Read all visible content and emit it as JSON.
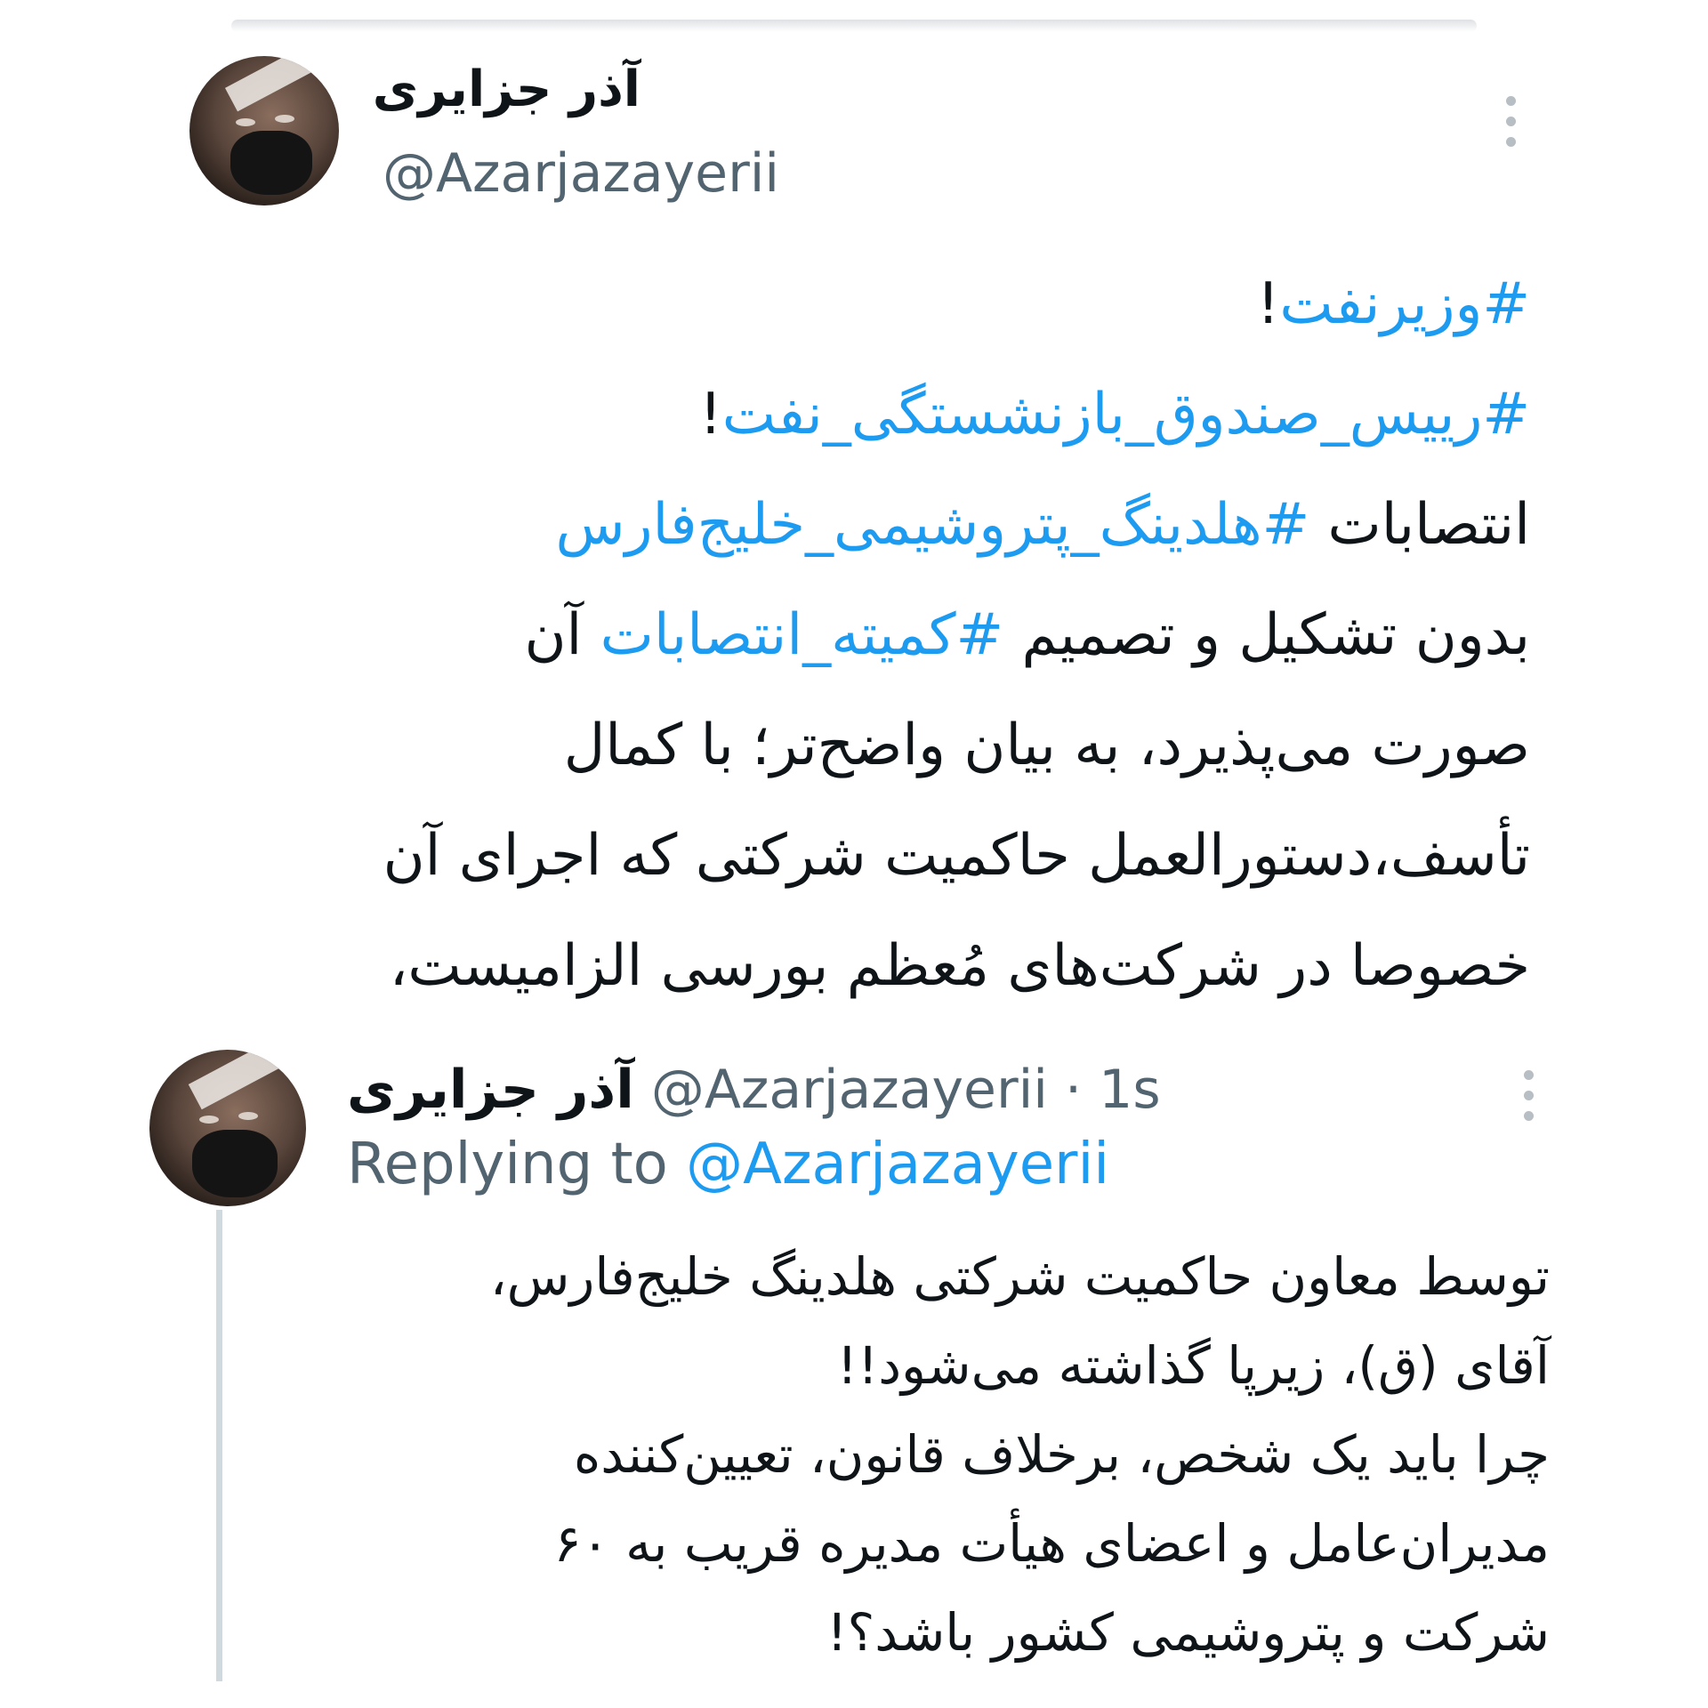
{
  "main_tweet": {
    "display_name": "آذر جزایری",
    "handle": "@Azarjazayerii",
    "lines": [
      [
        {
          "text": "#وزیرنفت",
          "tag": true
        },
        {
          "text": "!",
          "tag": false
        }
      ],
      [
        {
          "text": "#رییس_صندوق_بازنشستگی_نفت",
          "tag": true
        },
        {
          "text": "!",
          "tag": false
        }
      ],
      [
        {
          "text": "انتصابات ",
          "tag": false
        },
        {
          "text": "#هلدینگ_پتروشیمی_خلیج‌فارس",
          "tag": true
        }
      ],
      [
        {
          "text": "بدون تشکیل و تصمیم ",
          "tag": false
        },
        {
          "text": "#کمیته_انتصابات",
          "tag": true
        },
        {
          "text": " آن",
          "tag": false
        }
      ],
      [
        {
          "text": "صورت می‌پذیرد، به بیان واضح‌تر؛ با کمال",
          "tag": false
        }
      ],
      [
        {
          "text": "تأسف،دستورالعمل حاکمیت شرکتی که اجرای آن",
          "tag": false
        }
      ],
      [
        {
          "text": "خصوصا در شرکت‌های مُعظم بورسی الزامیست،",
          "tag": false
        }
      ]
    ]
  },
  "reply_tweet": {
    "display_name": "آذر جزایری",
    "handle": "@Azarjazayerii",
    "separator": " · ",
    "time": "1s",
    "replying_label": "Replying to ",
    "replying_handle": "@Azarjazayerii",
    "lines": [
      "توسط معاون حاکمیت شرکتی هلدینگ خلیج‌فارس،",
      "آقای (ق)، زیرپا گذاشته می‌شود!!",
      "چرا باید یک شخص، برخلاف قانون، تعیین‌کننده",
      "مدیران‌عامل و اعضای هیأت مدیره قریب به ۶۰",
      "شرکت و پتروشیمی کشور باشد؟!"
    ]
  },
  "icons": {
    "more": "more-vertical-icon",
    "avatar": "profile-avatar"
  },
  "colors": {
    "hashtag": "#1d9bf0",
    "secondary": "#536471",
    "text": "#0f1419",
    "thread_line": "#cfd9de"
  }
}
